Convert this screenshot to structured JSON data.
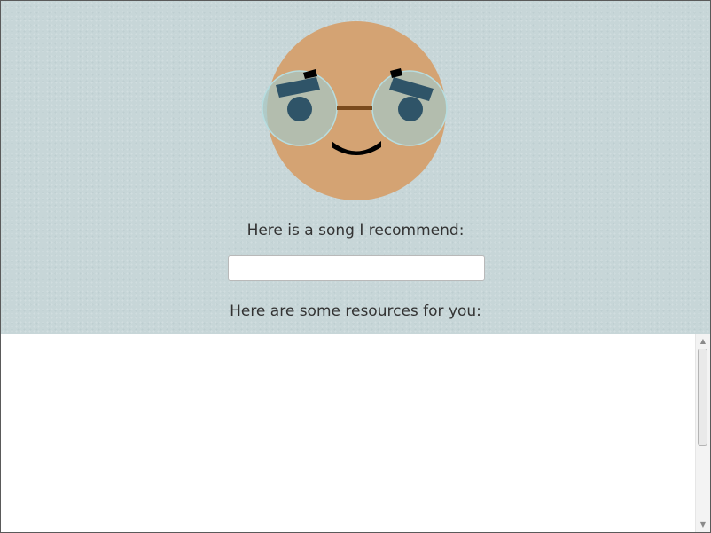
{
  "face": {
    "skin_color": "#d4a373",
    "brow_color": "#2f5468",
    "eye_color": "#2f5468",
    "lens_color": "#a8c5c2",
    "bridge_color": "#7a4a1d",
    "mouth_color": "#000000"
  },
  "song": {
    "label": "Here is a song I recommend:",
    "value": "",
    "placeholder": ""
  },
  "resources": {
    "label": "Here are some resources for you:"
  },
  "scrollbar": {
    "up_icon": "chevron-up-icon",
    "down_icon": "chevron-down-icon"
  }
}
